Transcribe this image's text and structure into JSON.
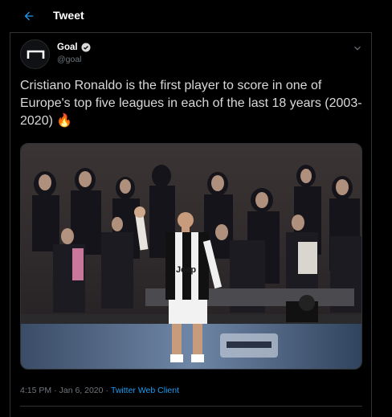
{
  "header": {
    "title": "Tweet",
    "back_icon": "arrow-left-icon",
    "accent": "#1d9bf0"
  },
  "author": {
    "name": "Goal",
    "handle": "@goal",
    "verified": true,
    "avatar_icon": "goal-logo"
  },
  "tweet": {
    "text": "Cristiano Ronaldo is the first player to score in one of Europe's top five leagues in each of the last 18 years (2003-2020) 🔥",
    "media_alt": "Cristiano Ronaldo celebrating in front of fans",
    "jersey_sponsor": "Jeep"
  },
  "meta": {
    "time": "4:15 PM",
    "date": "Jan 6, 2020",
    "separator": "·",
    "client": "Twitter Web Client"
  }
}
